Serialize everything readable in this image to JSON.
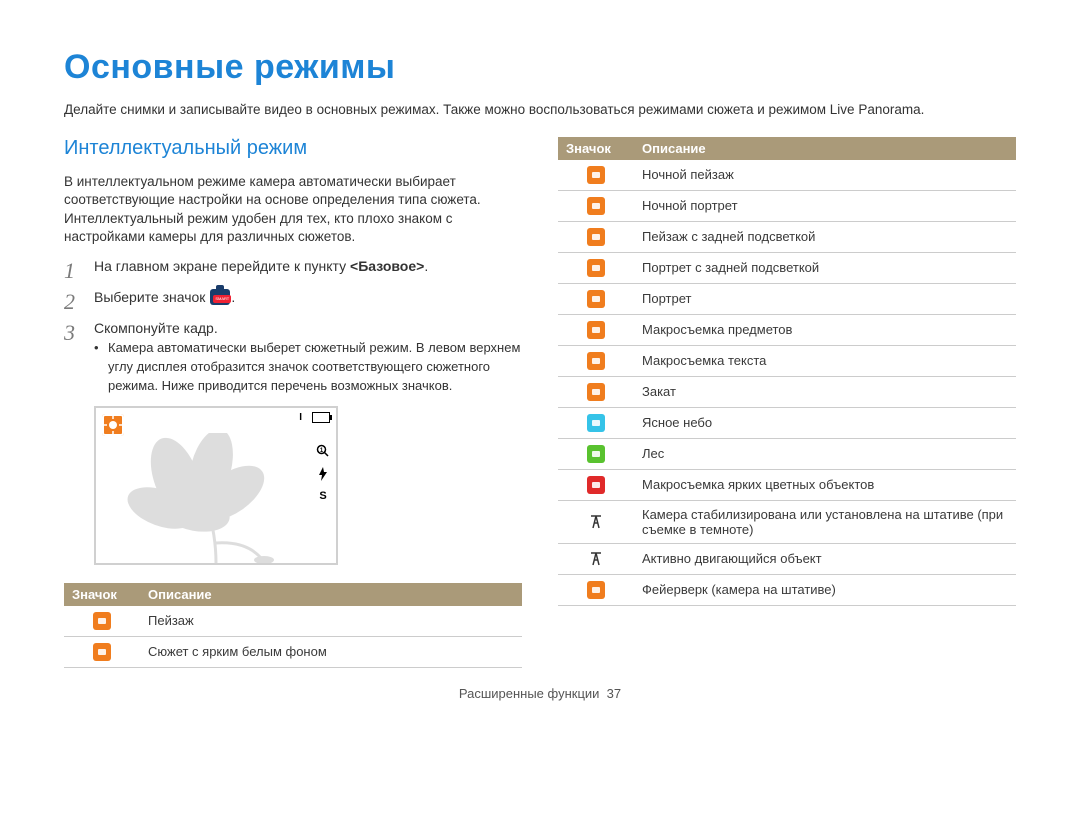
{
  "title": "Основные режимы",
  "intro": "Делайте снимки и записывайте видео в основных режимах. Также можно воспользоваться режимами сюжета и режимом Live Panorama.",
  "section_heading": "Интеллектуальный режим",
  "section_text": "В интеллектуальном режиме камера автоматически выбирает соответствующие настройки на основе определения типа сюжета. Интеллектуальный режим удобен для тех, кто плохо знаком с настройками камеры для различных сюжетов.",
  "steps": {
    "s1_a": "На главном экране перейдите к пункту ",
    "s1_b": "<Базовое>",
    "s1_c": ".",
    "s2_a": "Выберите значок ",
    "s2_b": ".",
    "s3": "Скомпонуйте кадр.",
    "s3_bullet": "Камера автоматически выберет сюжетный режим. В левом верхнем углу дисплея отобразится значок соответствующего сюжетного режима. Ниже приводится перечень возможных значков."
  },
  "screen_indicator": "I",
  "table_headers": {
    "icon": "Значок",
    "desc": "Описание"
  },
  "left_table": [
    {
      "color": "#f07d1e",
      "desc": "Пейзаж"
    },
    {
      "color": "#f07d1e",
      "desc": "Сюжет с ярким белым фоном"
    }
  ],
  "right_table": [
    {
      "color": "#f07d1e",
      "desc": "Ночной пейзаж"
    },
    {
      "color": "#f07d1e",
      "desc": "Ночной портрет"
    },
    {
      "color": "#f07d1e",
      "desc": "Пейзаж с задней подсветкой"
    },
    {
      "color": "#f07d1e",
      "desc": "Портрет с задней подсветкой"
    },
    {
      "color": "#f07d1e",
      "desc": "Портрет"
    },
    {
      "color": "#f07d1e",
      "desc": "Макросъемка предметов"
    },
    {
      "color": "#f07d1e",
      "desc": "Макросъемка текста"
    },
    {
      "color": "#f07d1e",
      "desc": "Закат"
    },
    {
      "color": "#35c3e8",
      "desc": "Ясное небо"
    },
    {
      "color": "#59c22f",
      "desc": "Лес"
    },
    {
      "color": "#e02a2a",
      "desc": "Макросъемка ярких цветных объектов"
    },
    {
      "color": "bare",
      "desc": "Камера стабилизирована или установлена на штативе (при съемке в темноте)"
    },
    {
      "color": "bare",
      "desc": "Активно двигающийся объект"
    },
    {
      "color": "#f07d1e",
      "desc": "Фейерверк (камера на штативе)"
    }
  ],
  "footer_label": "Расширенные функции",
  "footer_page": "37"
}
